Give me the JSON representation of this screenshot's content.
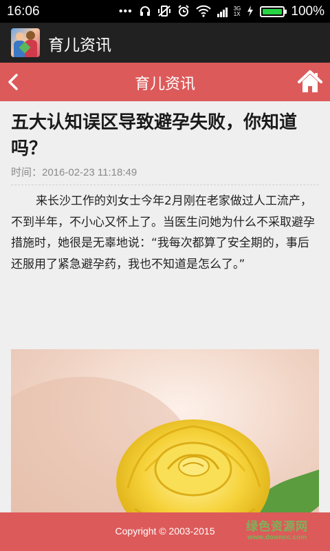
{
  "status_bar": {
    "time": "16:06",
    "icons": [
      "dots-icon",
      "headphones-icon",
      "vibrate-icon",
      "alarm-icon",
      "wifi-icon",
      "signal-icon",
      "charging-icon"
    ],
    "network_label_top": "3G",
    "network_label_bottom": "1X",
    "battery_percent": 100,
    "battery_text": "100%",
    "battery_color": "#27d444"
  },
  "app_bar": {
    "title": "育儿资讯"
  },
  "nav_bar": {
    "title": "育儿资讯",
    "back_icon": "chevron-left-icon",
    "home_icon": "home-icon",
    "color": "#dd5a5a"
  },
  "article": {
    "title": "五大认知误区导致避孕失败，你知道吗？",
    "time": "时间：2016-02-23 11:18:49",
    "body": "来长沙工作的刘女士今年2月刚在老家做过人工流产，不到半年，不小心又怀上了。当医生问她为什么不采取避孕措施时，她很是无辜地说：“我每次都算了安全期的，事后还服用了紧急避孕药，我也不知道是怎么了。”"
  },
  "footer": {
    "copyright": "Copyright © 2003-2015",
    "watermark_cn": "绿色资源网",
    "watermark_url": "www.downcc.com"
  }
}
